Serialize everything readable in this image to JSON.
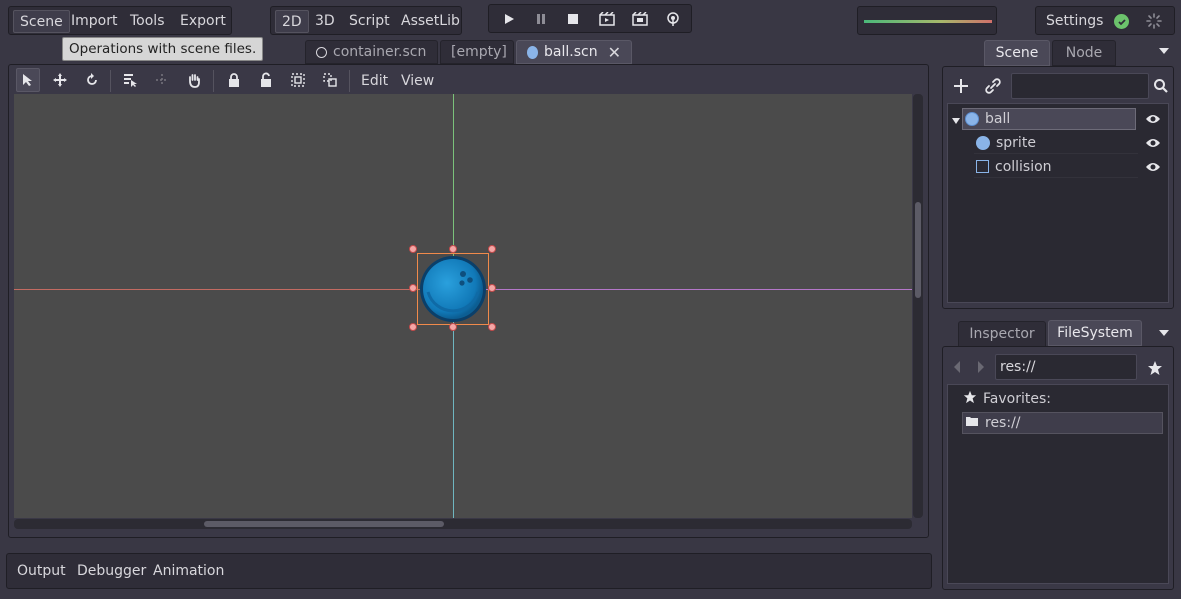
{
  "main_menu": {
    "scene": "Scene",
    "import": "Import",
    "tools": "Tools",
    "export": "Export"
  },
  "workspace_menu": {
    "two_d": "2D",
    "three_d": "3D",
    "script": "Script",
    "assetlib": "AssetLib"
  },
  "playback": {
    "play": "play-icon",
    "pause": "pause-icon",
    "stop": "stop-icon",
    "play_scene": "play-scene-icon",
    "play_custom": "play-custom-icon",
    "deploy": "remote-debug-icon"
  },
  "top_right": {
    "settings": "Settings"
  },
  "tooltip": "Operations with scene files.",
  "scene_tabs": [
    {
      "label": "container.scn"
    },
    {
      "label": "[empty]"
    },
    {
      "label": "ball.scn"
    }
  ],
  "canvas_toolbar": {
    "edit": "Edit",
    "view": "View"
  },
  "scene_dock": {
    "tabs": {
      "scene": "Scene",
      "node": "Node"
    },
    "search_placeholder": "",
    "tree": [
      {
        "label": "ball",
        "icon": "node2d-icon"
      },
      {
        "label": "sprite",
        "icon": "sprite-icon"
      },
      {
        "label": "collision",
        "icon": "collision-shape-icon"
      }
    ]
  },
  "fs_dock": {
    "tabs": {
      "inspector": "Inspector",
      "filesystem": "FileSystem"
    },
    "path": "res://",
    "favorites_label": "Favorites:",
    "folder": "res://"
  },
  "bottom_panel": {
    "output": "Output",
    "debugger": "Debugger",
    "animation": "Animation"
  },
  "colors": {
    "accent": "#5e9be0",
    "selection": "#f08a4b",
    "x_axis": "#d06a6a",
    "y_axis": "#8ad08a"
  }
}
